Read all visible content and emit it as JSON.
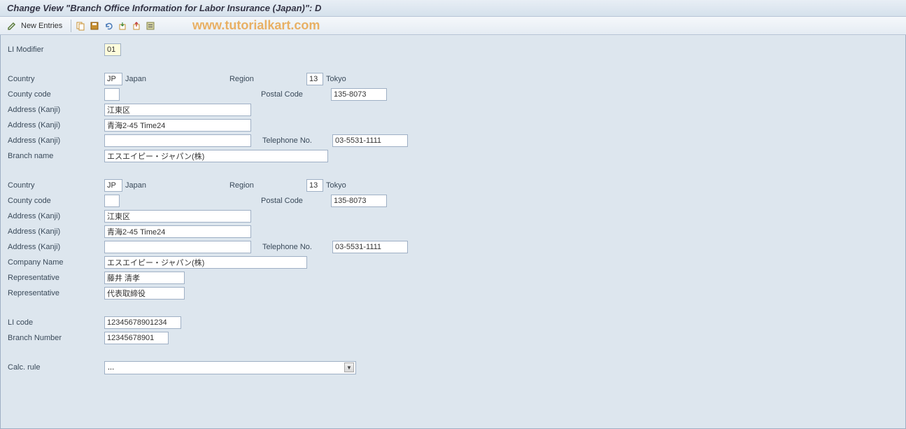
{
  "title": "Change View \"Branch Office Information for Labor Insurance (Japan)\": D",
  "toolbar": {
    "new_entries": "New Entries"
  },
  "watermark": "www.tutorialkart.com",
  "labels": {
    "li_modifier": "LI Modifier",
    "country": "Country",
    "region": "Region",
    "county_code": "County code",
    "postal_code": "Postal Code",
    "address_kanji": "Address (Kanji)",
    "telephone": "Telephone No.",
    "branch_name": "Branch name",
    "company_name": "Company Name",
    "representative": "Representative",
    "li_code": "LI code",
    "branch_number": "Branch Number",
    "calc_rule": "Calc. rule"
  },
  "block1": {
    "li_modifier": "01",
    "country": "JP",
    "country_text": "Japan",
    "region": "13",
    "region_text": "Tokyo",
    "county_code": "",
    "postal_code": "135-8073",
    "address1": "江東区",
    "address2": "青海2-45 Time24",
    "address3": "",
    "telephone": "03-5531-1111",
    "branch_name": "エスエイピー・ジャパン(株)"
  },
  "block2": {
    "country": "JP",
    "country_text": "Japan",
    "region": "13",
    "region_text": "Tokyo",
    "county_code": "",
    "postal_code": "135-8073",
    "address1": "江東区",
    "address2": "青海2-45 Time24",
    "address3": "",
    "telephone": "03-5531-1111",
    "company_name": "エスエイピー・ジャパン(株)",
    "representative1": "藤井 清孝",
    "representative2": "代表取締役"
  },
  "block3": {
    "li_code": "12345678901234",
    "branch_number": "12345678901"
  },
  "calc_rule": {
    "value": "..."
  }
}
